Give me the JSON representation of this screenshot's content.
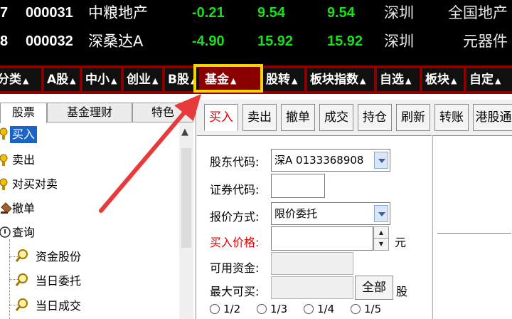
{
  "quotes": [
    {
      "idx": "7",
      "code": "000031",
      "name": "中粮地产",
      "change": "-0.21",
      "price": "9.54",
      "last": "9.54",
      "area": "深圳",
      "industry": "全国地产"
    },
    {
      "idx": "8",
      "code": "000032",
      "name": "深桑达A",
      "change": "-4.90",
      "price": "15.92",
      "last": "15.92",
      "area": "深圳",
      "industry": "元器件"
    }
  ],
  "category_tabs": [
    {
      "label": "分类"
    },
    {
      "label": "A股"
    },
    {
      "label": "中小"
    },
    {
      "label": "创业"
    },
    {
      "label": "B股"
    },
    {
      "label": "基金",
      "active": true
    },
    {
      "label": "股转"
    },
    {
      "label": "板块指数"
    },
    {
      "label": "自选"
    },
    {
      "label": "板块"
    },
    {
      "label": "自定"
    }
  ],
  "tab_arrow": "▲",
  "left_tabs": [
    {
      "label": "股票",
      "active": true
    },
    {
      "label": "基金理财"
    },
    {
      "label": "特色"
    }
  ],
  "tree_items": [
    {
      "label": "买入",
      "icon": "buy-icon",
      "selected": true
    },
    {
      "label": "卖出",
      "icon": "sell-icon"
    },
    {
      "label": "对买对卖",
      "icon": "buy-sell-icon"
    },
    {
      "label": "撤单",
      "icon": "cancel-order-icon"
    },
    {
      "label": "查询",
      "icon": "query-icon"
    },
    {
      "label": "资金股份",
      "icon": "magnifier-icon"
    },
    {
      "label": "当日委托",
      "icon": "magnifier-icon"
    },
    {
      "label": "当日成交",
      "icon": "magnifier-icon"
    }
  ],
  "trade_buttons": [
    {
      "label": "买入",
      "active": true
    },
    {
      "label": "卖出"
    },
    {
      "label": "撤单"
    },
    {
      "label": "成交"
    },
    {
      "label": "持仓"
    },
    {
      "label": "刷新"
    },
    {
      "label": "转账"
    },
    {
      "label": "港股通"
    }
  ],
  "form": {
    "holder_code_label": "股东代码:",
    "holder_code_value": "深A 0133368908",
    "security_code_label": "证券代码:",
    "security_code_value": "",
    "price_mode_label": "报价方式:",
    "price_mode_value": "限价委托",
    "buy_price_label": "买入价格:",
    "buy_price_value": "",
    "buy_price_unit": "元",
    "available_funds_label": "可用资金:",
    "available_funds_value": "",
    "max_buy_label": "最大可买:",
    "max_buy_value": "",
    "all_button": "全部",
    "max_buy_unit": "股",
    "fractions": [
      "1/2",
      "1/3",
      "1/4",
      "1/5"
    ]
  },
  "colors": {
    "price_down": "#18e018",
    "tab_strip": "#8a0000",
    "highlight_box": "#f5d500",
    "annotation_arrow": "#e83a3a",
    "selection": "#1a64c8"
  }
}
